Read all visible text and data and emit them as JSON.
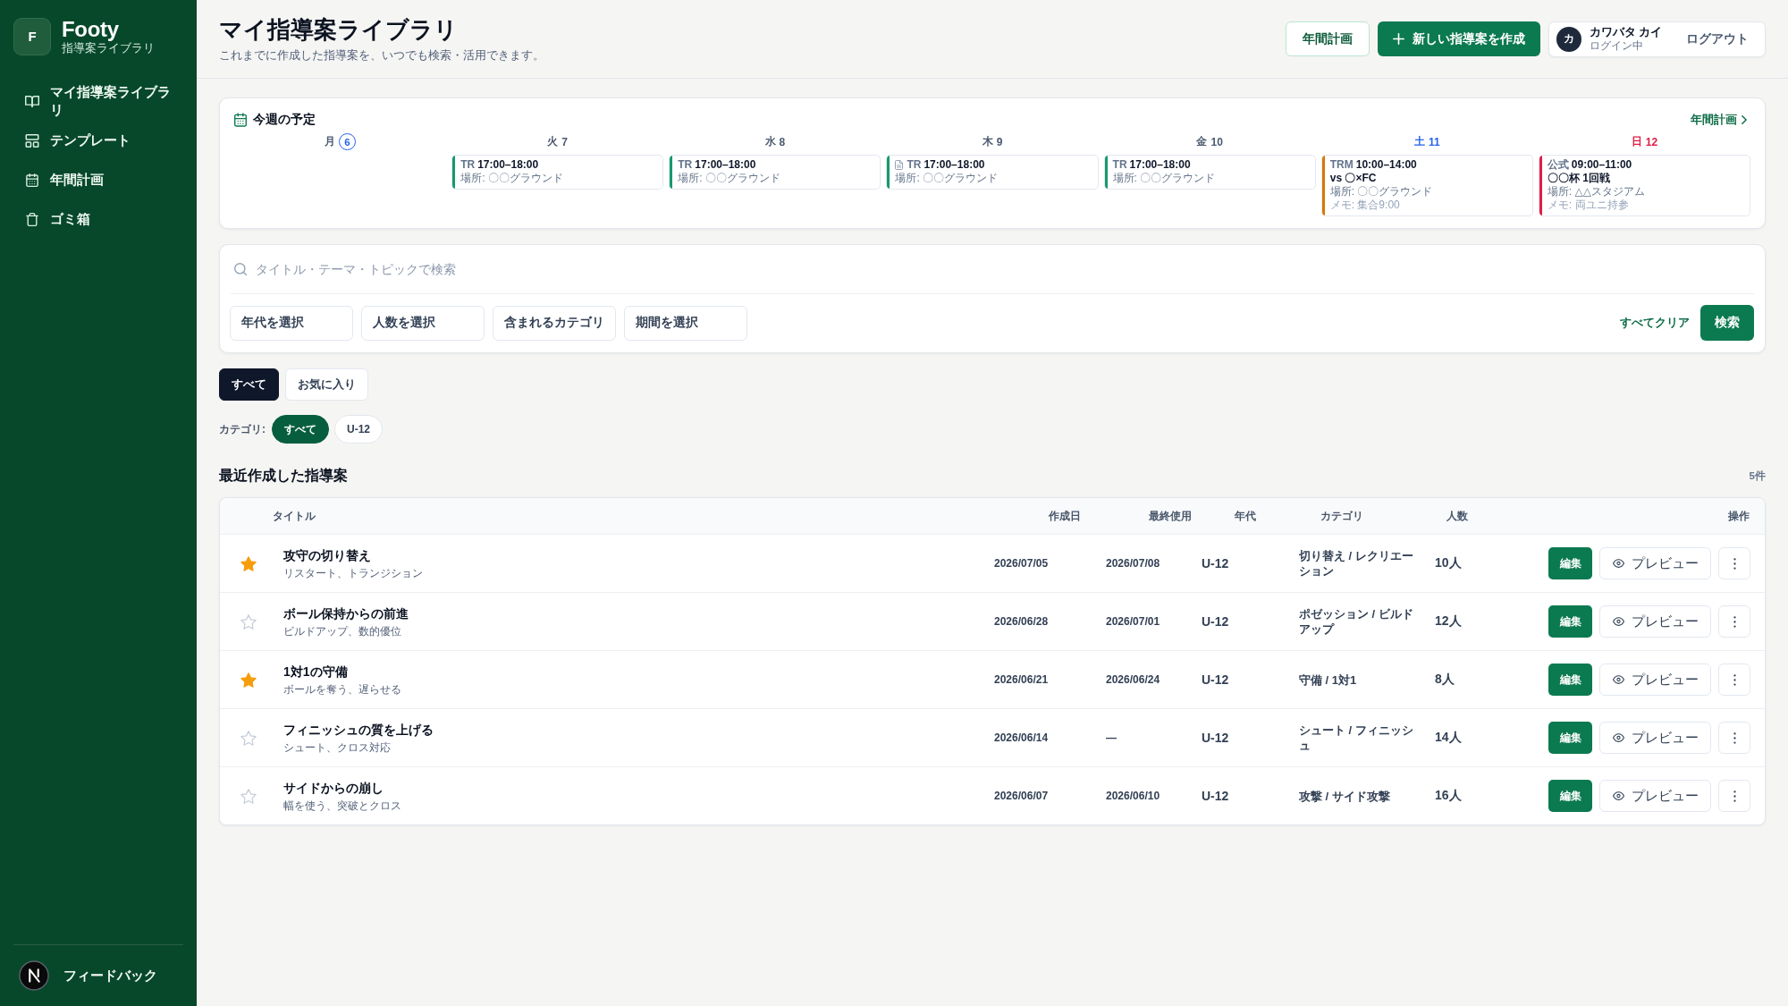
{
  "sidebar": {
    "brand": {
      "letter": "F",
      "name": "Footy",
      "tagline": "指導案ライブラリ"
    },
    "items": [
      {
        "label": "マイ指導案ライブラリ"
      },
      {
        "label": "テンプレート"
      },
      {
        "label": "年間計画"
      },
      {
        "label": "ゴミ箱"
      }
    ],
    "feedback": "フィードバック"
  },
  "header": {
    "title": "マイ指導案ライブラリ",
    "subtitle": "これまでに作成した指導案を、いつでも検索・活用できます。",
    "plan_button": "年間計画",
    "create_button": "新しい指導案を作成",
    "user": {
      "initial": "カ",
      "name": "カワバタ カイ",
      "status": "ログイン中",
      "logout": "ログアウト"
    }
  },
  "schedule": {
    "title": "今週の予定",
    "link": "年間計画",
    "days": [
      {
        "weekday": "月",
        "date": "6",
        "kind": "weekday",
        "today": true
      },
      {
        "weekday": "火",
        "date": "7",
        "kind": "weekday",
        "today": false,
        "events": [
          {
            "label": "TR",
            "time": "17:00–18:00",
            "place": "場所: 〇〇グラウンド",
            "color": "#169a6b",
            "document": false
          }
        ]
      },
      {
        "weekday": "水",
        "date": "8",
        "kind": "weekday",
        "today": false,
        "events": [
          {
            "label": "TR",
            "time": "17:00–18:00",
            "place": "場所: 〇〇グラウンド",
            "color": "#169a6b",
            "document": false
          }
        ]
      },
      {
        "weekday": "木",
        "date": "9",
        "kind": "weekday",
        "today": false,
        "events": [
          {
            "label": "TR",
            "time": "17:00–18:00",
            "place": "場所: 〇〇グラウンド",
            "color": "#169a6b",
            "document": true
          }
        ]
      },
      {
        "weekday": "金",
        "date": "10",
        "kind": "weekday",
        "today": false,
        "events": [
          {
            "label": "TR",
            "time": "17:00–18:00",
            "place": "場所: 〇〇グラウンド",
            "color": "#169a6b",
            "document": false
          }
        ]
      },
      {
        "weekday": "土",
        "date": "11",
        "kind": "saturday",
        "today": false,
        "events": [
          {
            "label": "TRM",
            "time": "10:00–14:00",
            "title": "vs 〇×FC",
            "place": "場所: 〇〇グラウンド",
            "memo": "メモ: 集合9:00",
            "color": "#d97706",
            "document": false
          }
        ]
      },
      {
        "weekday": "日",
        "date": "12",
        "kind": "sunday",
        "today": false,
        "events": [
          {
            "label": "公式",
            "time": "09:00–11:00",
            "title": "〇〇杯 1回戦",
            "place": "場所: △△スタジアム",
            "memo": "メモ: 両ユニ持参",
            "color": "#e11d48",
            "document": false
          }
        ]
      }
    ]
  },
  "search": {
    "placeholder": "タイトル・テーマ・トピックで検索",
    "filters": [
      "年代を選択",
      "人数を選択",
      "含まれるカテゴリ",
      "期間を選択"
    ],
    "clear": "すべてクリア",
    "submit": "検索"
  },
  "tabs": [
    {
      "label": "すべて",
      "selected": true
    },
    {
      "label": "お気に入り",
      "selected": false
    }
  ],
  "category_filter": {
    "label": "カテゴリ:",
    "chips": [
      {
        "label": "すべて",
        "selected": true
      },
      {
        "label": "U-12",
        "selected": false
      }
    ]
  },
  "section": {
    "title": "最近作成した指導案",
    "count": "5件"
  },
  "table": {
    "columns": [
      "タイトル",
      "作成日",
      "最終使用",
      "年代",
      "カテゴリ",
      "人数",
      "操作"
    ],
    "rows": [
      {
        "favorite": true,
        "title": "攻守の切り替え",
        "subtitle": "リスタート、トランジション",
        "created": "2026/07/05",
        "last_used": "2026/07/08",
        "age": "U-12",
        "category": "切り替え / レクリエーション",
        "players": "10人",
        "edit": "編集",
        "preview": "プレビュー"
      },
      {
        "favorite": false,
        "title": "ボール保持からの前進",
        "subtitle": "ビルドアップ、数的優位",
        "created": "2026/06/28",
        "last_used": "2026/07/01",
        "age": "U-12",
        "category": "ポゼッション / ビルドアップ",
        "players": "12人",
        "edit": "編集",
        "preview": "プレビュー"
      },
      {
        "favorite": true,
        "title": "1対1の守備",
        "subtitle": "ボールを奪う、遅らせる",
        "created": "2026/06/21",
        "last_used": "2026/06/24",
        "age": "U-12",
        "category": "守備 / 1対1",
        "players": "8人",
        "edit": "編集",
        "preview": "プレビュー"
      },
      {
        "favorite": false,
        "title": "フィニッシュの質を上げる",
        "subtitle": "シュート、クロス対応",
        "created": "2026/06/14",
        "last_used": "—",
        "age": "U-12",
        "category": "シュート / フィニッシュ",
        "players": "14人",
        "edit": "編集",
        "preview": "プレビュー"
      },
      {
        "favorite": false,
        "title": "サイドからの崩し",
        "subtitle": "幅を使う、突破とクロス",
        "created": "2026/06/07",
        "last_used": "2026/06/10",
        "age": "U-12",
        "category": "攻撃 / サイド攻撃",
        "players": "16人",
        "edit": "編集",
        "preview": "プレビュー"
      }
    ]
  }
}
